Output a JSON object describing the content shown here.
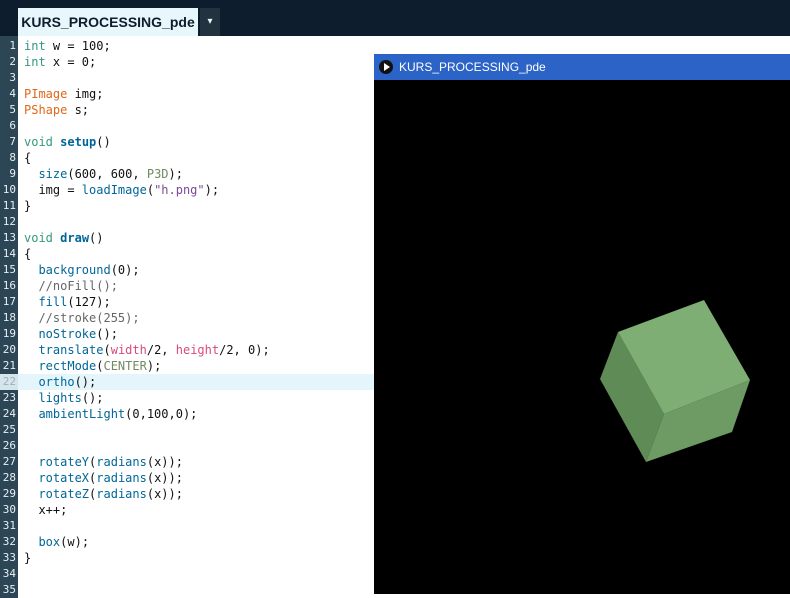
{
  "header": {
    "tab_label": "KURS_PROCESSING_pde",
    "tab_menu_icon": "▾"
  },
  "editor": {
    "active_line": 22,
    "lines": [
      {
        "n": "1",
        "html": "<span class='kw'>int</span> w = 100;"
      },
      {
        "n": "2",
        "html": "<span class='kw'>int</span> x = 0;"
      },
      {
        "n": "3",
        "html": ""
      },
      {
        "n": "4",
        "html": "<span class='type'>PImage</span> img;"
      },
      {
        "n": "5",
        "html": "<span class='type'>PShape</span> s;"
      },
      {
        "n": "6",
        "html": ""
      },
      {
        "n": "7",
        "html": "<span class='kw'>void</span> <span class='fnb'>setup</span>()"
      },
      {
        "n": "8",
        "html": "{"
      },
      {
        "n": "9",
        "html": "  <span class='fn'>size</span>(600, 600, <span class='const'>P3D</span>);"
      },
      {
        "n": "10",
        "html": "  img = <span class='fn'>loadImage</span>(<span class='str'>\"h.png\"</span>);"
      },
      {
        "n": "11",
        "html": "}"
      },
      {
        "n": "12",
        "html": ""
      },
      {
        "n": "13",
        "html": "<span class='kw'>void</span> <span class='fnb'>draw</span>()"
      },
      {
        "n": "14",
        "html": "{"
      },
      {
        "n": "15",
        "html": "  <span class='fn'>background</span>(0);"
      },
      {
        "n": "16",
        "html": "  <span class='cmt'>//noFill();</span>"
      },
      {
        "n": "17",
        "html": "  <span class='fn'>fill</span>(127);"
      },
      {
        "n": "18",
        "html": "  <span class='cmt'>//stroke(255);</span>"
      },
      {
        "n": "19",
        "html": "  <span class='fn'>noStroke</span>();"
      },
      {
        "n": "20",
        "html": "  <span class='fn'>translate</span>(<span class='var'>width</span>/2, <span class='var'>height</span>/2, 0);"
      },
      {
        "n": "21",
        "html": "  <span class='fn'>rectMode</span>(<span class='const'>CENTER</span>);"
      },
      {
        "n": "22",
        "html": "  <span class='fn'>ortho</span>();"
      },
      {
        "n": "23",
        "html": "  <span class='fn'>lights</span>();"
      },
      {
        "n": "24",
        "html": "  <span class='fn'>ambientLight</span>(0,100,0);"
      },
      {
        "n": "25",
        "html": ""
      },
      {
        "n": "26",
        "html": ""
      },
      {
        "n": "27",
        "html": "  <span class='fn'>rotateY</span>(<span class='fn'>radians</span>(x));"
      },
      {
        "n": "28",
        "html": "  <span class='fn'>rotateX</span>(<span class='fn'>radians</span>(x));"
      },
      {
        "n": "29",
        "html": "  <span class='fn'>rotateZ</span>(<span class='fn'>radians</span>(x));"
      },
      {
        "n": "30",
        "html": "  x++;"
      },
      {
        "n": "31",
        "html": ""
      },
      {
        "n": "32",
        "html": "  <span class='fn'>box</span>(w);"
      },
      {
        "n": "33",
        "html": "}"
      },
      {
        "n": "34",
        "html": ""
      },
      {
        "n": "35",
        "html": ""
      }
    ]
  },
  "sketch_window": {
    "title": "KURS_PROCESSING_pde",
    "title_icon": "play-icon",
    "colors": {
      "title_bar": "#2b63c6",
      "cube_top": "#7fae74",
      "cube_left": "#5f8c56",
      "cube_right": "#6d9b63"
    }
  }
}
